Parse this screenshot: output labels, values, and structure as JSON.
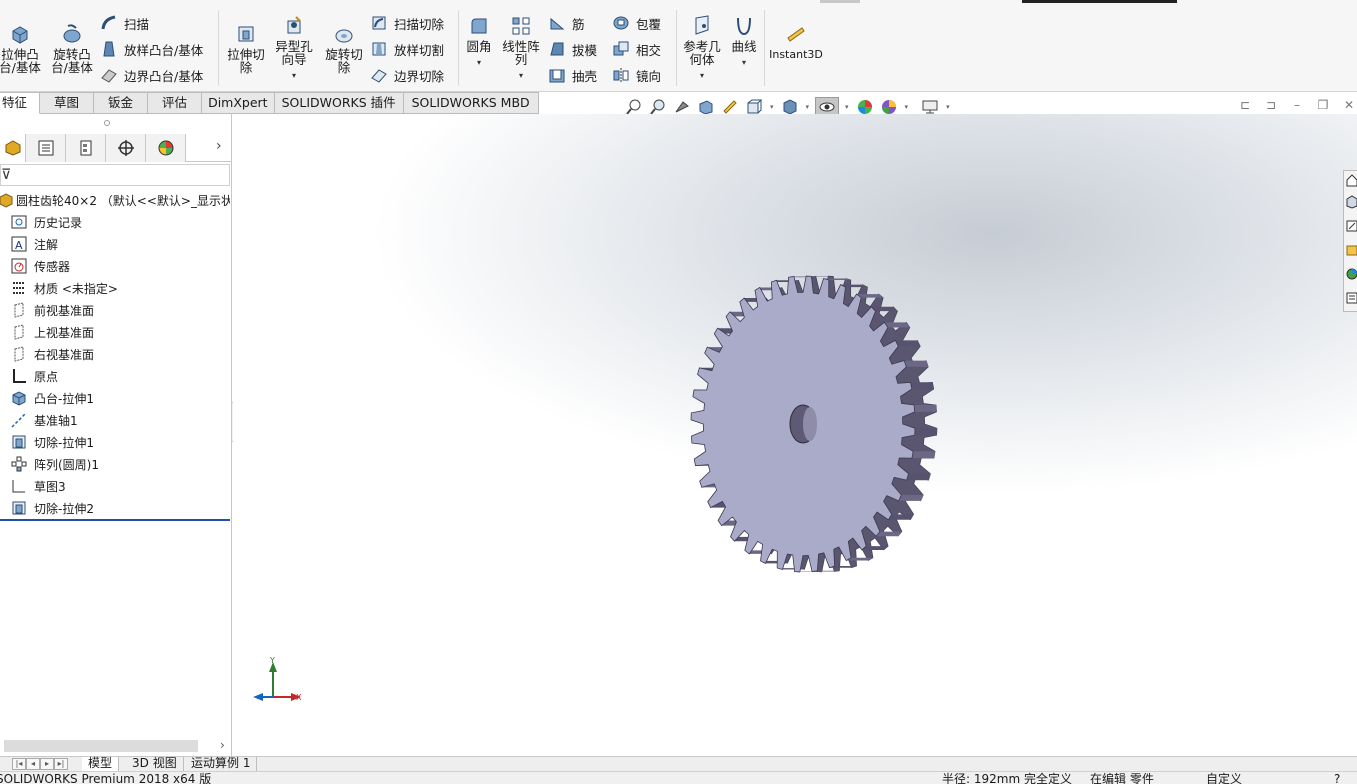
{
  "ribbon": {
    "extrude_boss": "拉伸凸\n台/基体",
    "revolve_boss": "旋转凸\n台/基体",
    "sweep": "扫描",
    "loft_boss": "放样凸台/基体",
    "boundary_boss": "边界凸台/基体",
    "extrude_cut": "拉伸切\n除",
    "hole_wizard": "异型孔\n向导",
    "revolve_cut": "旋转切\n除",
    "swept_cut": "扫描切除",
    "lofted_cut": "放样切割",
    "boundary_cut": "边界切除",
    "fillet": "圆角",
    "linear_pattern": "线性阵\n列",
    "rib": "筋",
    "draft": "拔模",
    "shell": "抽壳",
    "wrap": "包覆",
    "intersect": "相交",
    "mirror": "镜向",
    "reference_geometry": "参考几\n何体",
    "curves": "曲线",
    "instant3d": "Instant3D"
  },
  "tabs": [
    "特征",
    "草图",
    "钣金",
    "评估",
    "DimXpert",
    "SOLIDWORKS 插件",
    "SOLIDWORKS MBD"
  ],
  "active_tab": "特征",
  "tree": {
    "root": "圆柱齿轮40×2 （默认<<默认>_显示状态",
    "items": [
      {
        "label": "历史记录",
        "icon": "history-icon"
      },
      {
        "label": "注解",
        "icon": "annotation-icon"
      },
      {
        "label": "传感器",
        "icon": "sensor-icon"
      },
      {
        "label": "材质 <未指定>",
        "icon": "material-icon"
      },
      {
        "label": "前视基准面",
        "icon": "plane-icon"
      },
      {
        "label": "上视基准面",
        "icon": "plane-icon"
      },
      {
        "label": "右视基准面",
        "icon": "plane-icon"
      },
      {
        "label": "原点",
        "icon": "origin-icon"
      },
      {
        "label": "凸台-拉伸1",
        "icon": "boss-extrude-icon"
      },
      {
        "label": "基准轴1",
        "icon": "axis-icon"
      },
      {
        "label": "切除-拉伸1",
        "icon": "cut-extrude-icon"
      },
      {
        "label": "阵列(圆周)1",
        "icon": "circular-pattern-icon"
      },
      {
        "label": "草图3",
        "icon": "sketch-icon"
      },
      {
        "label": "切除-拉伸2",
        "icon": "cut-extrude-icon"
      }
    ]
  },
  "bottom_tabs": [
    "模型",
    "3D 视图",
    "运动算例 1"
  ],
  "status": {
    "app": "SOLIDWORKS Premium 2018 x64 版",
    "radius": "半径: 192mm",
    "defined": "完全定义",
    "editing": "在编辑 零件",
    "custom": "自定义"
  },
  "triad": {
    "x": "X",
    "y": "Y"
  },
  "colors": {
    "accent": "#1f4fa8",
    "gear_face": "#a9abc9",
    "gear_tooth": "#5a5670"
  }
}
